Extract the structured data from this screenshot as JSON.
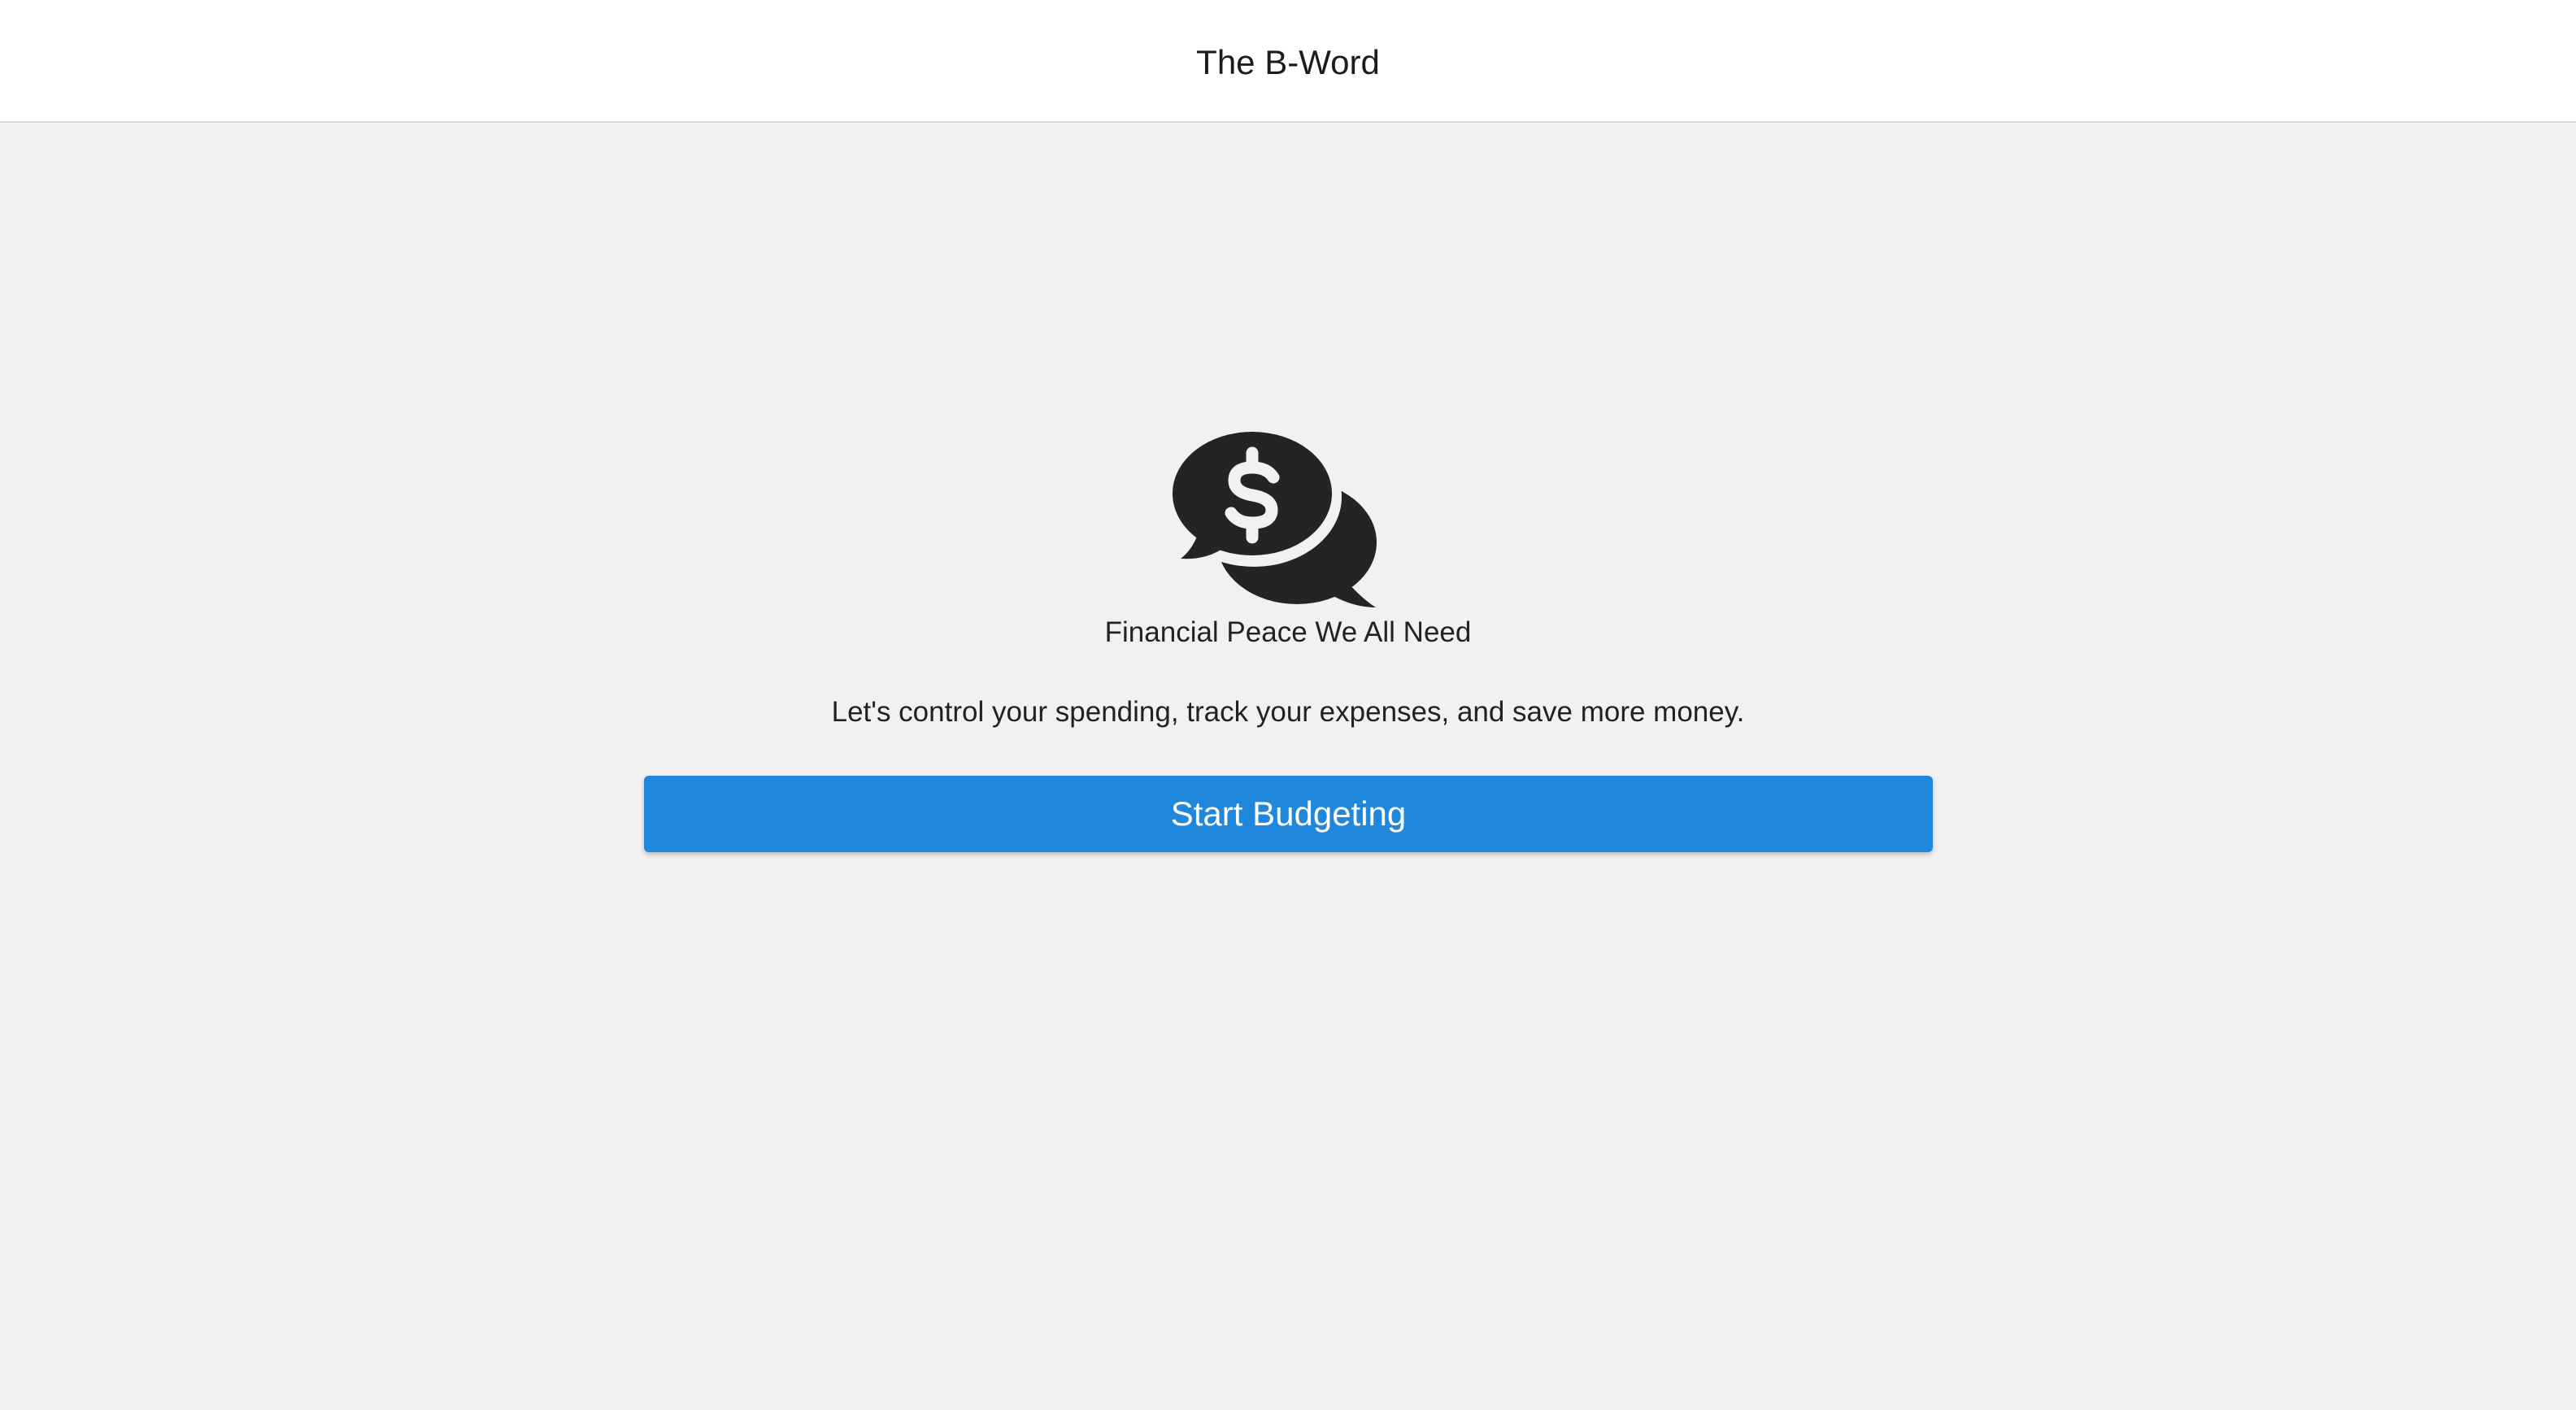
{
  "header": {
    "title": "The B-Word"
  },
  "hero": {
    "icon": "comments-dollar-icon",
    "tagline": "Financial Peace We All Need",
    "description": "Let's control your spending, track your expenses, and save more money.",
    "cta_label": "Start Budgeting"
  },
  "colors": {
    "header_bg": "#ffffff",
    "page_bg": "#f1f1f1",
    "text": "#222222",
    "accent": "#2088dc",
    "button_text": "#ffffff"
  }
}
